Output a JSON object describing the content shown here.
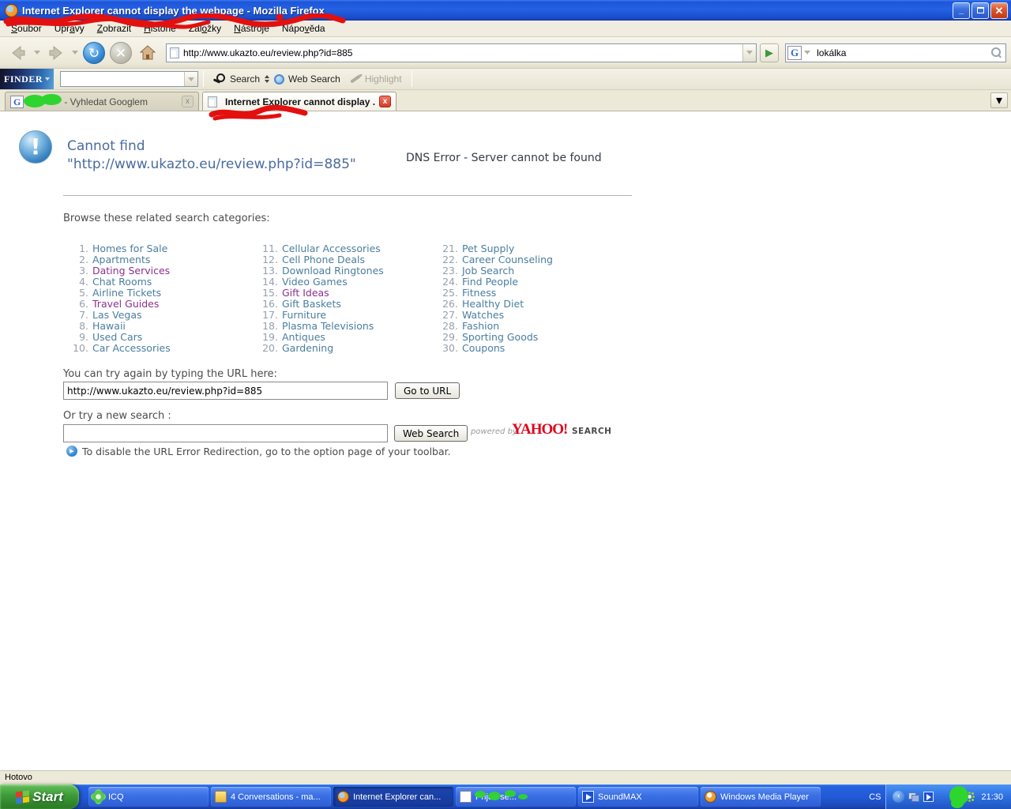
{
  "colors": {
    "scribble_red": "#e31010",
    "scribble_green": "#2ed52e",
    "link": "#4a7e9f",
    "link_visited": "#8b3190",
    "yahoo_red": "#e0001a"
  },
  "window": {
    "title": "Internet Explorer cannot display the webpage - Mozilla Firefox",
    "minimize_glyph": "_",
    "close_glyph": "✕"
  },
  "menubar": {
    "items": [
      {
        "pre": "",
        "key": "S",
        "post": "oubor"
      },
      {
        "pre": "Úpr",
        "key": "a",
        "post": "vy"
      },
      {
        "pre": "",
        "key": "Z",
        "post": "obrazit"
      },
      {
        "pre": "",
        "key": "H",
        "post": "istorie"
      },
      {
        "pre": "Zál",
        "key": "o",
        "post": "žky"
      },
      {
        "pre": "",
        "key": "N",
        "post": "ástroje"
      },
      {
        "pre": "Nápo",
        "key": "v",
        "post": "ěda"
      }
    ]
  },
  "navbar": {
    "url": "http://www.ukazto.eu/review.php?id=885",
    "reload_glyph": "↻",
    "stop_glyph": "✕",
    "go_glyph": "▶",
    "search_engine_letter": "G",
    "search_value": "lokálka"
  },
  "finderbar": {
    "logo": "FINDER",
    "search_label": "Search",
    "web_search_label": "Web Search",
    "highlight_label": "Highlight"
  },
  "tabbar": {
    "tabs": [
      {
        "label": "- Vyhledat Googlem",
        "engine_letter": "G"
      },
      {
        "label": "Internet Explorer cannot display ..."
      }
    ],
    "close_glyph": "x",
    "overflow_glyph": "▾"
  },
  "page": {
    "heading_line1": "Cannot find",
    "heading_line2": "\"http://www.ukazto.eu/review.php?id=885\"",
    "dns_error": "DNS Error - Server cannot be found",
    "browse_heading": "Browse these related search categories:",
    "categories": [
      {
        "num": "1.",
        "label": "Homes for Sale"
      },
      {
        "num": "2.",
        "label": "Apartments"
      },
      {
        "num": "3.",
        "label": "Dating Services",
        "visited": true
      },
      {
        "num": "4.",
        "label": "Chat Rooms"
      },
      {
        "num": "5.",
        "label": "Airline Tickets"
      },
      {
        "num": "6.",
        "label": "Travel Guides",
        "visited": true
      },
      {
        "num": "7.",
        "label": "Las Vegas"
      },
      {
        "num": "8.",
        "label": "Hawaii"
      },
      {
        "num": "9.",
        "label": "Used Cars"
      },
      {
        "num": "10.",
        "label": "Car Accessories"
      },
      {
        "num": "11.",
        "label": "Cellular Accessories"
      },
      {
        "num": "12.",
        "label": "Cell Phone Deals"
      },
      {
        "num": "13.",
        "label": "Download Ringtones"
      },
      {
        "num": "14.",
        "label": "Video Games"
      },
      {
        "num": "15.",
        "label": "Gift Ideas",
        "visited": true
      },
      {
        "num": "16.",
        "label": "Gift Baskets"
      },
      {
        "num": "17.",
        "label": "Furniture"
      },
      {
        "num": "18.",
        "label": "Plasma Televisions"
      },
      {
        "num": "19.",
        "label": "Antiques"
      },
      {
        "num": "20.",
        "label": "Gardening"
      },
      {
        "num": "21.",
        "label": "Pet Supply"
      },
      {
        "num": "22.",
        "label": "Career Counseling"
      },
      {
        "num": "23.",
        "label": "Job Search"
      },
      {
        "num": "24.",
        "label": "Find People"
      },
      {
        "num": "25.",
        "label": "Fitness"
      },
      {
        "num": "26.",
        "label": "Healthy Diet"
      },
      {
        "num": "27.",
        "label": "Watches"
      },
      {
        "num": "28.",
        "label": "Fashion"
      },
      {
        "num": "29.",
        "label": "Sporting Goods"
      },
      {
        "num": "30.",
        "label": "Coupons"
      }
    ],
    "retry_label": "You can try again by typing the URL here:",
    "url_value": "http://www.ukazto.eu/review.php?id=885",
    "go_button": "Go to URL",
    "new_search_label": "Or try a new search :",
    "web_search_button": "Web Search",
    "powered_by": "powered by",
    "yahoo": "YAHOO!",
    "yahoo_search": "SEARCH",
    "note_glyph": "▶",
    "note": "To disable the URL Error Redirection, go to the option page of your toolbar."
  },
  "statusbar": {
    "text": "Hotovo"
  },
  "taskbar": {
    "start_label": "Start",
    "tasks": [
      {
        "label": "ICQ",
        "icon": "icq-flower-icon"
      },
      {
        "label": "4 Conversations - ma...",
        "icon": "conversations-icon"
      },
      {
        "label": "Internet Explorer can...",
        "icon": "firefox-icon",
        "active": true
      },
      {
        "label": "Přijde se...",
        "icon": "word-doc-icon",
        "scribbled": true
      },
      {
        "label": "SoundMAX",
        "icon": "soundmax-icon"
      },
      {
        "label": "Windows Media Player",
        "icon": "wmp-icon"
      }
    ],
    "word_icon_letter": "W",
    "language": "CS",
    "time": "21:30"
  }
}
